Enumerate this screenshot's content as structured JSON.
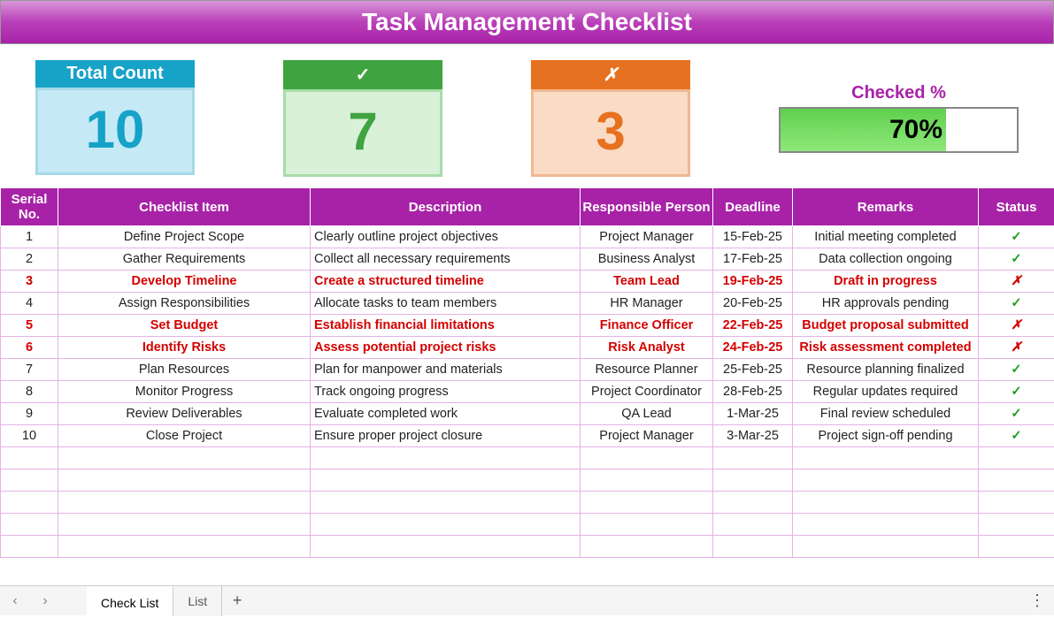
{
  "title": "Task Management Checklist",
  "cards": {
    "total": {
      "label": "Total Count",
      "value": "10"
    },
    "checked": {
      "label": "✓",
      "value": "7"
    },
    "unchecked": {
      "label": "✗",
      "value": "3"
    }
  },
  "progress": {
    "label": "Checked %",
    "value": "70%",
    "fill_pct": 70
  },
  "columns": {
    "sn": "Serial No.",
    "item": "Checklist Item",
    "desc": "Description",
    "resp": "Responsible Person",
    "dead": "Deadline",
    "rem": "Remarks",
    "stat": "Status"
  },
  "rows": [
    {
      "sn": "1",
      "item": "Define Project Scope",
      "desc": "Clearly outline project objectives",
      "resp": "Project Manager",
      "dead": "15-Feb-25",
      "rem": "Initial meeting completed",
      "status": "✓",
      "flag": false
    },
    {
      "sn": "2",
      "item": "Gather Requirements",
      "desc": "Collect all necessary requirements",
      "resp": "Business Analyst",
      "dead": "17-Feb-25",
      "rem": "Data collection ongoing",
      "status": "✓",
      "flag": false
    },
    {
      "sn": "3",
      "item": "Develop Timeline",
      "desc": "Create a structured timeline",
      "resp": "Team Lead",
      "dead": "19-Feb-25",
      "rem": "Draft in progress",
      "status": "✗",
      "flag": true
    },
    {
      "sn": "4",
      "item": "Assign Responsibilities",
      "desc": "Allocate tasks to team members",
      "resp": "HR Manager",
      "dead": "20-Feb-25",
      "rem": "HR approvals pending",
      "status": "✓",
      "flag": false
    },
    {
      "sn": "5",
      "item": "Set Budget",
      "desc": "Establish financial limitations",
      "resp": "Finance Officer",
      "dead": "22-Feb-25",
      "rem": "Budget proposal submitted",
      "status": "✗",
      "flag": true
    },
    {
      "sn": "6",
      "item": "Identify Risks",
      "desc": "Assess potential project risks",
      "resp": "Risk Analyst",
      "dead": "24-Feb-25",
      "rem": "Risk assessment completed",
      "status": "✗",
      "flag": true
    },
    {
      "sn": "7",
      "item": "Plan Resources",
      "desc": "Plan for manpower and materials",
      "resp": "Resource Planner",
      "dead": "25-Feb-25",
      "rem": "Resource planning finalized",
      "status": "✓",
      "flag": false
    },
    {
      "sn": "8",
      "item": "Monitor Progress",
      "desc": "Track ongoing progress",
      "resp": "Project Coordinator",
      "dead": "28-Feb-25",
      "rem": "Regular updates required",
      "status": "✓",
      "flag": false
    },
    {
      "sn": "9",
      "item": "Review Deliverables",
      "desc": "Evaluate completed work",
      "resp": "QA Lead",
      "dead": "1-Mar-25",
      "rem": "Final review scheduled",
      "status": "✓",
      "flag": false
    },
    {
      "sn": "10",
      "item": "Close Project",
      "desc": "Ensure proper project closure",
      "resp": "Project Manager",
      "dead": "3-Mar-25",
      "rem": "Project sign-off pending",
      "status": "✓",
      "flag": false
    }
  ],
  "empty_row_count": 5,
  "tabs": {
    "active": "Check List",
    "other": "List"
  }
}
